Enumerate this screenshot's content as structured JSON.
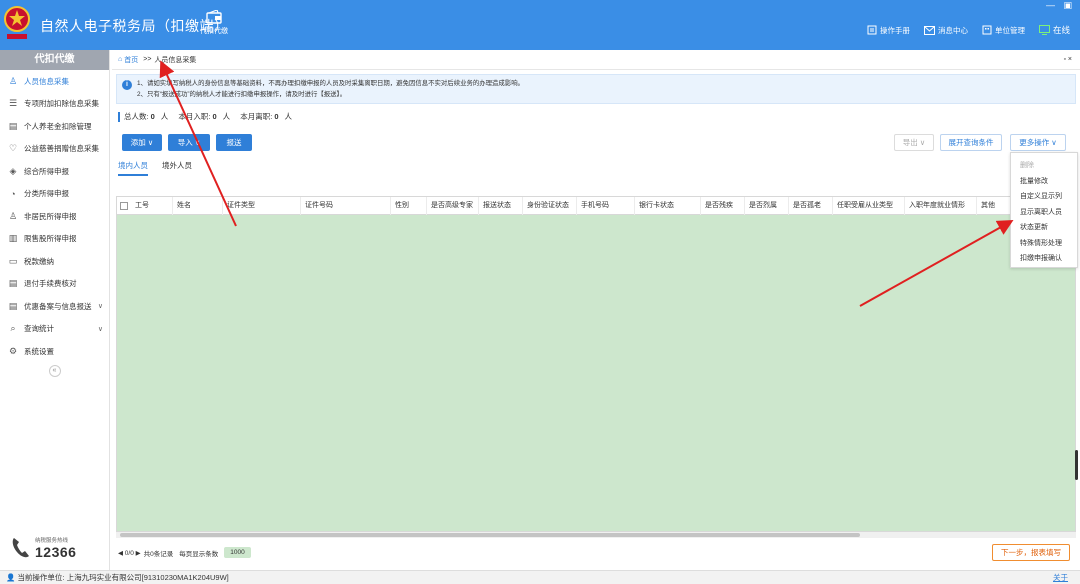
{
  "app": {
    "title": "自然人电子税务局（扣缴端）",
    "nav_tab": "代扣代缴",
    "window_controls": [
      "—",
      "▣"
    ],
    "links": [
      "操作手册",
      "消息中心",
      "单位管理",
      "在线"
    ]
  },
  "sidebar": {
    "header": "代扣代缴",
    "items": [
      {
        "label": "人员信息采集",
        "icon": "person-icon",
        "active": true
      },
      {
        "label": "专项附加扣除信息采集",
        "icon": "list-icon"
      },
      {
        "label": "个人养老金扣除管理",
        "icon": "doc-icon"
      },
      {
        "label": "公益慈善捐赠信息采集",
        "icon": "heart-icon"
      },
      {
        "label": "综合所得申报",
        "icon": "layers-icon"
      },
      {
        "label": "分类所得申报",
        "icon": "pie-icon"
      },
      {
        "label": "非居民所得申报",
        "icon": "person-icon"
      },
      {
        "label": "限售股所得申报",
        "icon": "bar-icon"
      },
      {
        "label": "税款缴纳",
        "icon": "folder-icon"
      },
      {
        "label": "退付手续费核对",
        "icon": "doc-icon"
      },
      {
        "label": "优惠备案与信息报送",
        "icon": "doc-icon",
        "chevron": "∨"
      },
      {
        "label": "查询统计",
        "icon": "search-icon",
        "chevron": "∨"
      },
      {
        "label": "系统设置",
        "icon": "gear-icon"
      }
    ],
    "collapse": "«",
    "hotline_label": "纳税服务热线",
    "hotline_number": "12366"
  },
  "breadcrumb": {
    "home": "首页",
    "sep": ">>",
    "current": "人员信息采集",
    "close": "▫ ×"
  },
  "notice": {
    "icon": "i",
    "line1": "1、请如实填写纳税人的身份信息等基础资料，不再办理扣缴申报的人员及时采集离职日期，避免因信息不实对后续业务的办理造成影响。",
    "line2": "2、只有“报送成功”的纳税人才能进行扣缴申报操作，请及时进行【报送】。"
  },
  "stats": {
    "total_label": "总人数:",
    "total": "0",
    "unit1": "人",
    "joined_label": "本月入职:",
    "joined": "0",
    "unit2": "人",
    "left_label": "本月离职:",
    "left": "0",
    "unit3": "人"
  },
  "toolbar": {
    "add": "添加",
    "import": "导入",
    "submit": "报送",
    "export": "导出",
    "expand_query": "展开查询条件",
    "more": "更多操作",
    "caret": "∨"
  },
  "tabs": [
    "境内人员",
    "境外人员"
  ],
  "table": {
    "columns": [
      "工号",
      "姓名",
      "证件类型",
      "证件号码",
      "性别",
      "是否高级专家",
      "报送状态",
      "身份验证状态",
      "手机号码",
      "银行卡状态",
      "是否残疾",
      "是否烈属",
      "是否孤老",
      "任职受雇从业类型",
      "入职年度就业情形",
      "其他"
    ]
  },
  "pager": {
    "nav": "◀ 0/0 ▶",
    "count": "共0条记录",
    "page_size_label": "每页显示条数",
    "page_size": "1000"
  },
  "next_button": "下一步，报表填写",
  "dropdown": {
    "items": [
      {
        "label": "删除",
        "disabled": true
      },
      {
        "label": "批量修改"
      },
      {
        "label": "自定义显示列"
      },
      {
        "label": "显示离职人员"
      },
      {
        "label": "状态更新"
      },
      {
        "label": "特殊情形处理"
      },
      {
        "label": "扣缴申报确认"
      }
    ]
  },
  "status_bar": {
    "label": "当前操作单位:",
    "company": "上海九玛实业有限公司[91310230MA1K204U9W]",
    "about": "关于"
  },
  "colors": {
    "titlebar": "#3a8ee6",
    "primary": "#2f7fd8",
    "grid_bg": "#cde7cd",
    "annotation_arrow": "#e02020"
  }
}
